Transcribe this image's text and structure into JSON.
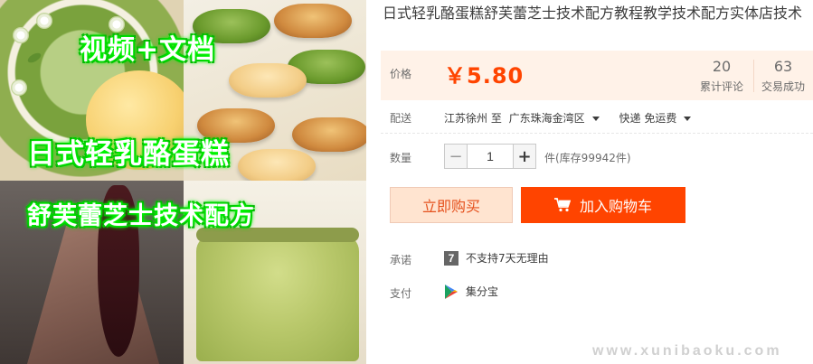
{
  "product": {
    "title": "日式轻乳酪蛋糕舒芙蕾芝士技术配方教程教学技术配方实体店技术",
    "image": {
      "banners": [
        "视频+文档",
        "日式轻乳酪蛋糕",
        "舒芙蕾芝士技术配方"
      ]
    }
  },
  "price": {
    "label": "价格",
    "value": "￥5.80",
    "reviews_count": "20",
    "reviews_label": "累计评论",
    "sales_count": "63",
    "sales_label": "交易成功"
  },
  "shipping": {
    "label": "配送",
    "origin": "江苏徐州 至",
    "destination": "广东珠海金湾区",
    "method": "快递 免运费"
  },
  "quantity": {
    "label": "数量",
    "value": "1",
    "minus": "−",
    "plus": "+",
    "stock": "件(库存99942件)"
  },
  "actions": {
    "buy_now": "立即购买",
    "add_to_cart": "加入购物车"
  },
  "promise": {
    "label": "承诺",
    "icon_glyph": "7",
    "text": "不支持7天无理由"
  },
  "payment": {
    "label": "支付",
    "text": "集分宝"
  },
  "watermark": "www.xunibaoku.com",
  "colors": {
    "accent": "#ff4400",
    "price_panel_bg": "#fff2e8",
    "buy_now_bg": "#ffe4d0"
  }
}
